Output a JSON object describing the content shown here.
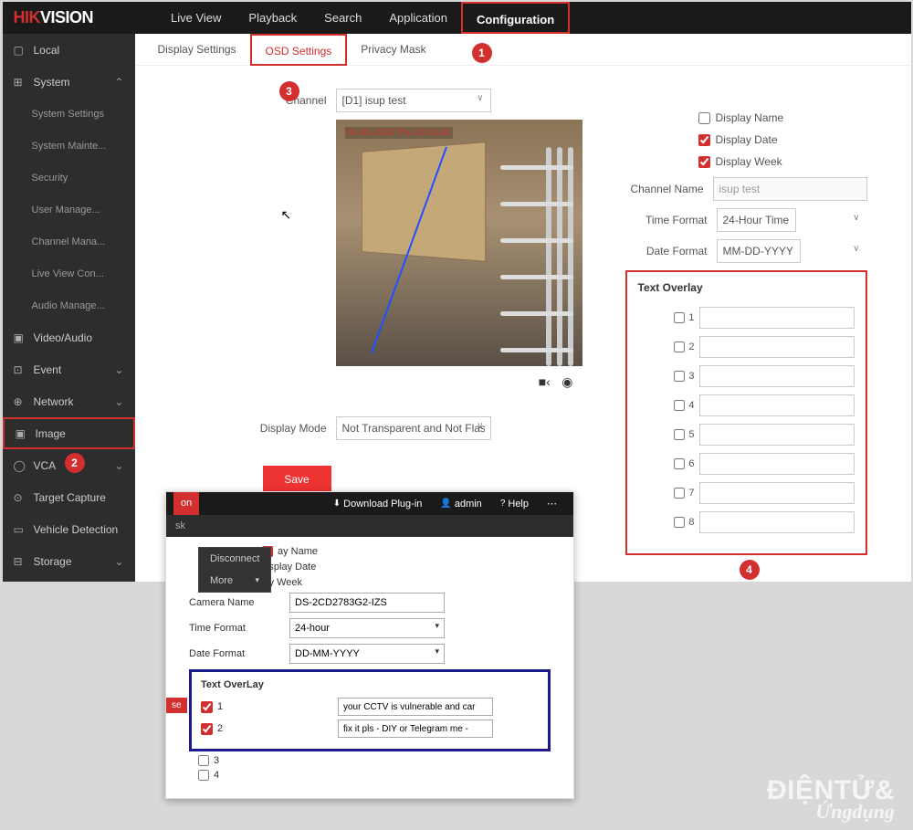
{
  "brand": {
    "part1": "HIK",
    "part2": "VISION"
  },
  "mainNav": [
    "Live View",
    "Playback",
    "Search",
    "Application",
    "Configuration"
  ],
  "activeNav": "Configuration",
  "sidebar": {
    "local": "Local",
    "system": "System",
    "systemItems": [
      "System Settings",
      "System Mainte...",
      "Security",
      "User Manage...",
      "Channel Mana...",
      "Live View Con...",
      "Audio Manage..."
    ],
    "rest": [
      {
        "icon": "camera-icon",
        "label": "Video/Audio"
      },
      {
        "icon": "event-icon",
        "label": "Event",
        "chevron": true
      },
      {
        "icon": "network-icon",
        "label": "Network",
        "chevron": true
      },
      {
        "icon": "image-icon",
        "label": "Image",
        "hi": true
      },
      {
        "icon": "vca-icon",
        "label": "VCA",
        "chevron": true,
        "badge": true
      },
      {
        "icon": "target-icon",
        "label": "Target Capture"
      },
      {
        "icon": "vehicle-icon",
        "label": "Vehicle Detection"
      },
      {
        "icon": "storage-icon",
        "label": "Storage",
        "chevron": true
      }
    ]
  },
  "subTabs": [
    "Display Settings",
    "OSD Settings",
    "Privacy Mask"
  ],
  "activeSubTab": "OSD Settings",
  "form": {
    "channelLabel": "Channel",
    "channelValue": "[D1] isup test",
    "previewDate": "01-02-2023 Thu 20:13:41",
    "displayModeLabel": "Display Mode",
    "displayModeValue": "Not Transparent and Not Flas...",
    "saveLabel": "Save"
  },
  "rightPanel": {
    "displayName": "Display Name",
    "displayDate": "Display Date",
    "displayWeek": "Display Week",
    "channelNameLabel": "Channel Name",
    "channelNameValue": "isup test",
    "timeFormatLabel": "Time Format",
    "timeFormatValue": "24-Hour Time",
    "dateFormatLabel": "Date Format",
    "dateFormatValue": "MM-DD-YYYY",
    "textOverlayTitle": "Text Overlay",
    "overlayNums": [
      "1",
      "2",
      "3",
      "4",
      "5",
      "6",
      "7",
      "8"
    ]
  },
  "secondary": {
    "headerTab": "on",
    "downloadPlugin": "Download Plug-in",
    "admin": "admin",
    "help": "Help",
    "subHeader": "sk",
    "dropdownDisconnect": "Disconnect",
    "dropdownMore": "More",
    "displayNamePartial": "ay Name",
    "displayDate": "Display Date",
    "displayWeek": "Display Week",
    "cameraNameLabel": "Camera Name",
    "cameraNameValue": "DS-2CD2783G2-IZS",
    "timeFormatLabel": "Time Format",
    "timeFormatValue": "24-hour",
    "dateFormatLabel": "Date Format",
    "dateFormatValue": "DD-MM-YYYY",
    "textOverlayTitle": "Text OverLay",
    "overlay1": "your CCTV is vulnerable and car",
    "overlay2": "fix it pls - DIY or Telegram me -",
    "closeLabel": "se"
  },
  "watermark": {
    "line1": "ĐIỆNTỬ&",
    "line2": "Ứngdụng"
  },
  "badges": {
    "1": "1",
    "2": "2",
    "3": "3",
    "4": "4"
  }
}
